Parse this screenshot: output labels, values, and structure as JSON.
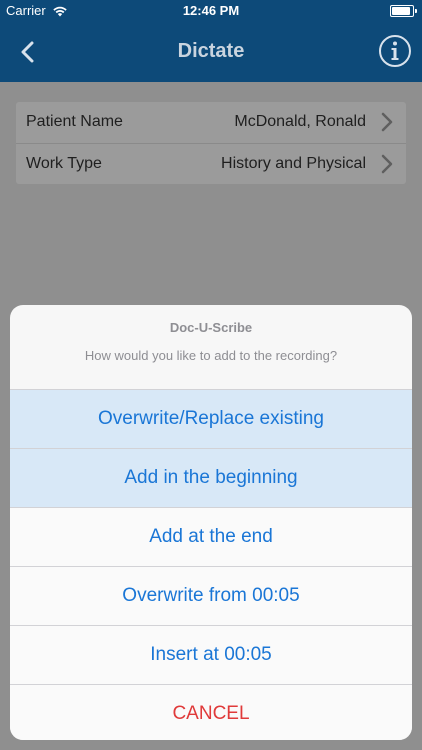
{
  "status_bar": {
    "carrier": "Carrier",
    "time": "12:46 PM",
    "battery_level": 1.0
  },
  "nav": {
    "title": "Dictate",
    "back_icon": "chevron-left-icon",
    "info_icon": "info-icon"
  },
  "form": {
    "rows": [
      {
        "label": "Patient Name",
        "value": "McDonald, Ronald"
      },
      {
        "label": "Work Type",
        "value": "History and Physical"
      }
    ]
  },
  "action_sheet": {
    "title": "Doc-U-Scribe",
    "message": "How would you like to add to the recording?",
    "options": [
      {
        "label": "Overwrite/Replace existing"
      },
      {
        "label": "Add in the beginning"
      },
      {
        "label": "Add at the end"
      },
      {
        "label": "Overwrite from 00:05"
      },
      {
        "label": "Insert at 00:05"
      }
    ],
    "cancel": "CANCEL"
  },
  "colors": {
    "nav_background": "#0d4a79",
    "action_blue": "#1a76d6",
    "cancel_red": "#e03a3a"
  }
}
